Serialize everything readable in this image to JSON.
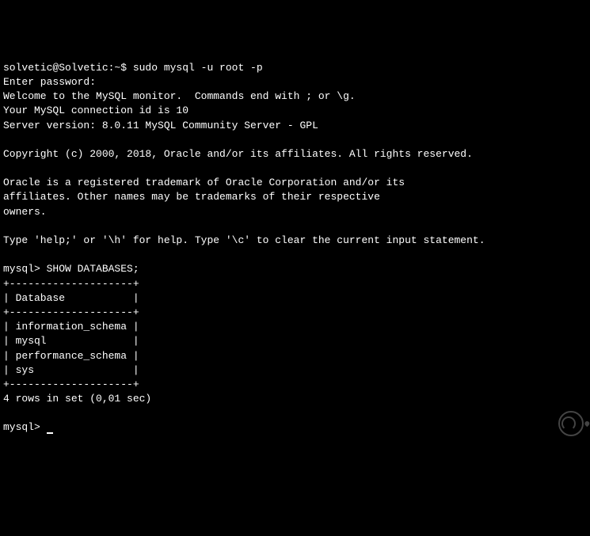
{
  "shell_prompt": "solvetic@Solvetic:~$ ",
  "shell_command": "sudo mysql -u root -p",
  "enter_password": "Enter password:",
  "welcome_line": "Welcome to the MySQL monitor.  Commands end with ; or \\g.",
  "connection_id_line": "Your MySQL connection id is 10",
  "server_version_line": "Server version: 8.0.11 MySQL Community Server - GPL",
  "copyright_line": "Copyright (c) 2000, 2018, Oracle and/or its affiliates. All rights reserved.",
  "trademark_line1": "Oracle is a registered trademark of Oracle Corporation and/or its",
  "trademark_line2": "affiliates. Other names may be trademarks of their respective",
  "trademark_line3": "owners.",
  "help_line": "Type 'help;' or '\\h' for help. Type '\\c' to clear the current input statement.",
  "mysql_prompt": "mysql> ",
  "sql_command": "SHOW DATABASES;",
  "table_border": "+--------------------+",
  "table_header": "| Database           |",
  "table_row1": "| information_schema |",
  "table_row2": "| mysql              |",
  "table_row3": "| performance_schema |",
  "table_row4": "| sys                |",
  "result_summary": "4 rows in set (0,01 sec)"
}
